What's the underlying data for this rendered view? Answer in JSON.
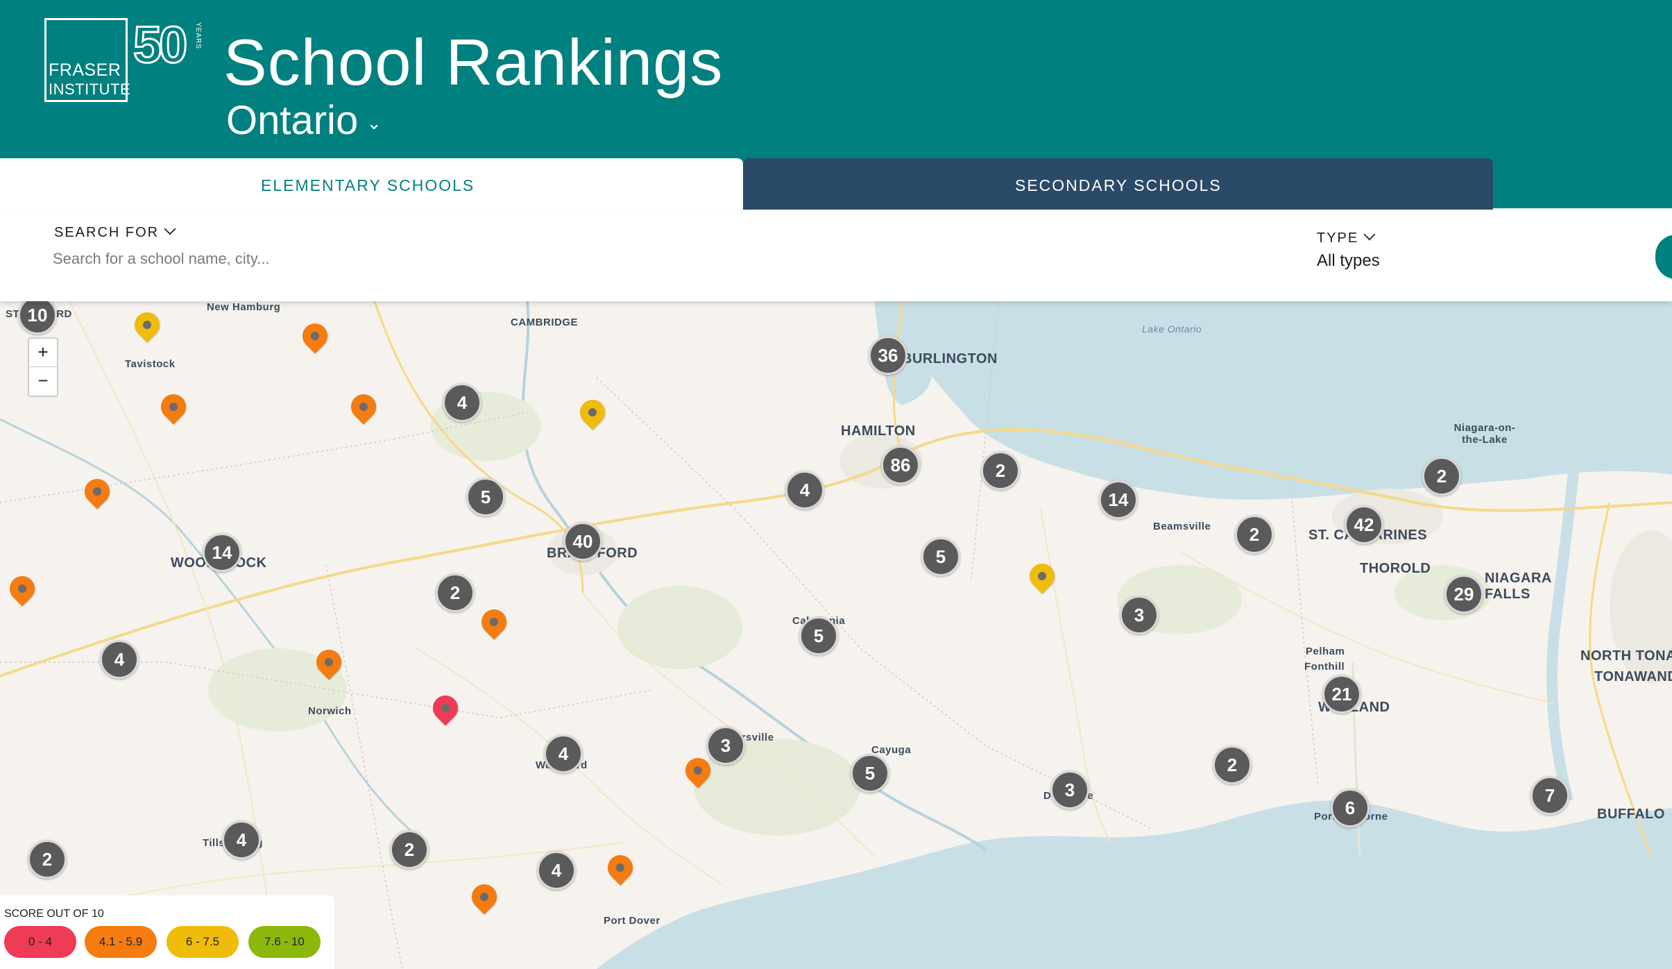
{
  "header": {
    "logo_line1": "FRASER",
    "logo_line2": "INSTITUTE",
    "logo_50": "50",
    "logo_years": "YEARS",
    "title": "School Rankings",
    "region": "Ontario"
  },
  "tabs": {
    "elementary": "ELEMENTARY SCHOOLS",
    "secondary": "SECONDARY SCHOOLS"
  },
  "search": {
    "label": "SEARCH FOR",
    "placeholder": "Search for a school name, city..."
  },
  "type_filter": {
    "label": "TYPE",
    "value": "All types"
  },
  "map": {
    "zoom_in": "+",
    "zoom_out": "−",
    "labels": [
      "CAMBRIDGE",
      "Tavistock",
      "New Hamburg",
      "BURLINGTON",
      "Lake Ontario",
      "HAMILTON",
      "Niagara-on-the-Lake",
      "Beamsville",
      "ST. CATHARINES",
      "THOROLD",
      "NIAGARA FALLS",
      "WOODSTOCK",
      "BRANTFORD",
      "Caledonia",
      "Pelham",
      "Fonthill",
      "NORTH TONAWANDA",
      "TONAWANDA",
      "WELLAND",
      "Norwich",
      "Hagersville",
      "Waterford",
      "Cayuga",
      "Dunnville",
      "Port Colborne",
      "BUFFALO",
      "Tillsonburg",
      "Port Dover",
      "STRATFORD"
    ],
    "clusters": [
      "10",
      "4",
      "5",
      "40",
      "14",
      "2",
      "4",
      "36",
      "86",
      "4",
      "2",
      "5",
      "14",
      "2",
      "42",
      "2",
      "29",
      "3",
      "5",
      "21",
      "4",
      "3",
      "5",
      "3",
      "2",
      "6",
      "7",
      "4",
      "2",
      "2",
      "4"
    ],
    "school_pins": [
      "yellow",
      "orange",
      "orange",
      "orange",
      "yellow",
      "orange",
      "orange",
      "orange",
      "orange",
      "yellow",
      "red",
      "orange",
      "orange",
      "orange"
    ]
  },
  "legend": {
    "title": "SCORE OUT OF 10",
    "ranges": [
      {
        "label": "0 - 4",
        "color": "#ee3b56"
      },
      {
        "label": "4.1 - 5.9",
        "color": "#f47c10"
      },
      {
        "label": "6 - 7.5",
        "color": "#f0bc0c"
      },
      {
        "label": "7.6 - 10",
        "color": "#8cb80c"
      }
    ]
  },
  "colors": {
    "header_bg": "#00807f",
    "secondary_tab_bg": "#2b4a68",
    "water": "#c9dfe6",
    "cluster": "#5a5a5a"
  }
}
